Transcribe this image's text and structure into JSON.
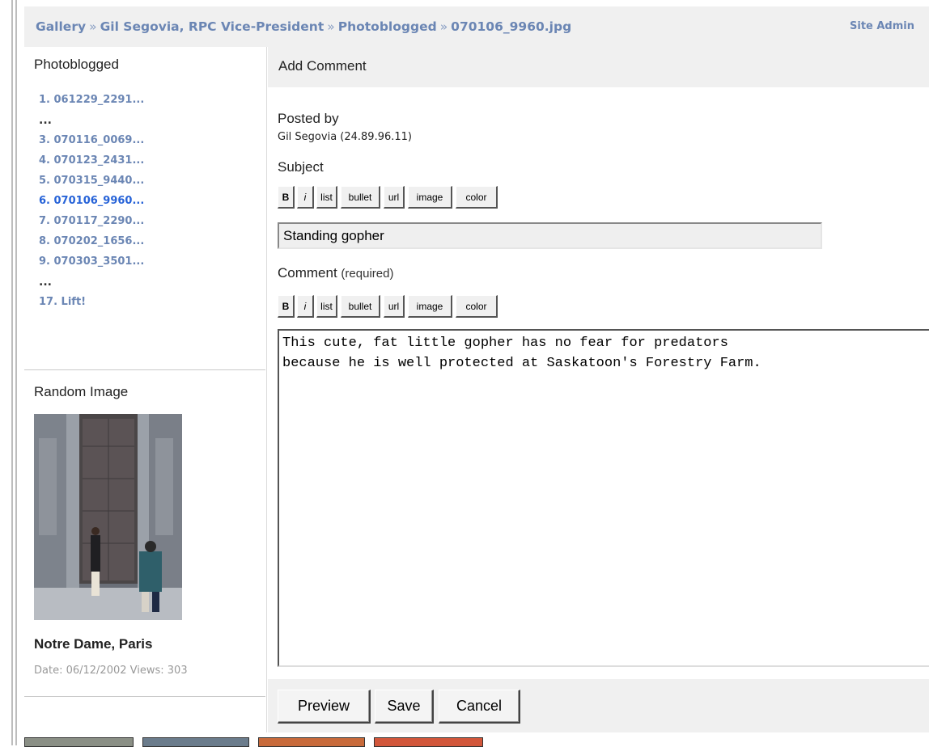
{
  "breadcrumb": {
    "items": [
      "Gallery",
      "Gil Segovia, RPC Vice-President",
      "Photoblogged",
      "070106_9960.jpg"
    ],
    "separator": "»",
    "site_admin": "Site Admin"
  },
  "sidebar": {
    "album_title": "Photoblogged",
    "items": [
      {
        "label": "1. 061229_2291..."
      },
      {
        "label": "..."
      },
      {
        "label": "3. 070116_0069..."
      },
      {
        "label": "4. 070123_2431..."
      },
      {
        "label": "5. 070315_9440..."
      },
      {
        "label": "6. 070106_9960..."
      },
      {
        "label": "7. 070117_2290..."
      },
      {
        "label": "8. 070202_1656..."
      },
      {
        "label": "9. 070303_3501..."
      },
      {
        "label": "..."
      },
      {
        "label": "17. Lift!"
      }
    ],
    "random_title": "Random Image",
    "random_caption": "Notre Dame, Paris",
    "random_meta": "Date: 06/12/2002 Views: 303"
  },
  "form": {
    "title": "Add Comment",
    "posted_by_label": "Posted by",
    "posted_by_value": "Gil Segovia (24.89.96.11)",
    "subject_label": "Subject",
    "subject_value": "Standing gopher",
    "comment_label": "Comment",
    "comment_required": "(required)",
    "comment_value": "This cute, fat little gopher has no fear for predators\nbecause he is well protected at Saskatoon's Forestry Farm.",
    "toolbar": {
      "bold": "B",
      "italic": "i",
      "list": "list",
      "bullet": "bullet",
      "url": "url",
      "image": "image",
      "color": "color"
    },
    "buttons": {
      "preview": "Preview",
      "save": "Save",
      "cancel": "Cancel"
    }
  },
  "colors": {
    "link": "#6b86b4",
    "current": "#2763d8",
    "panel_bg": "#f0f0f0"
  }
}
